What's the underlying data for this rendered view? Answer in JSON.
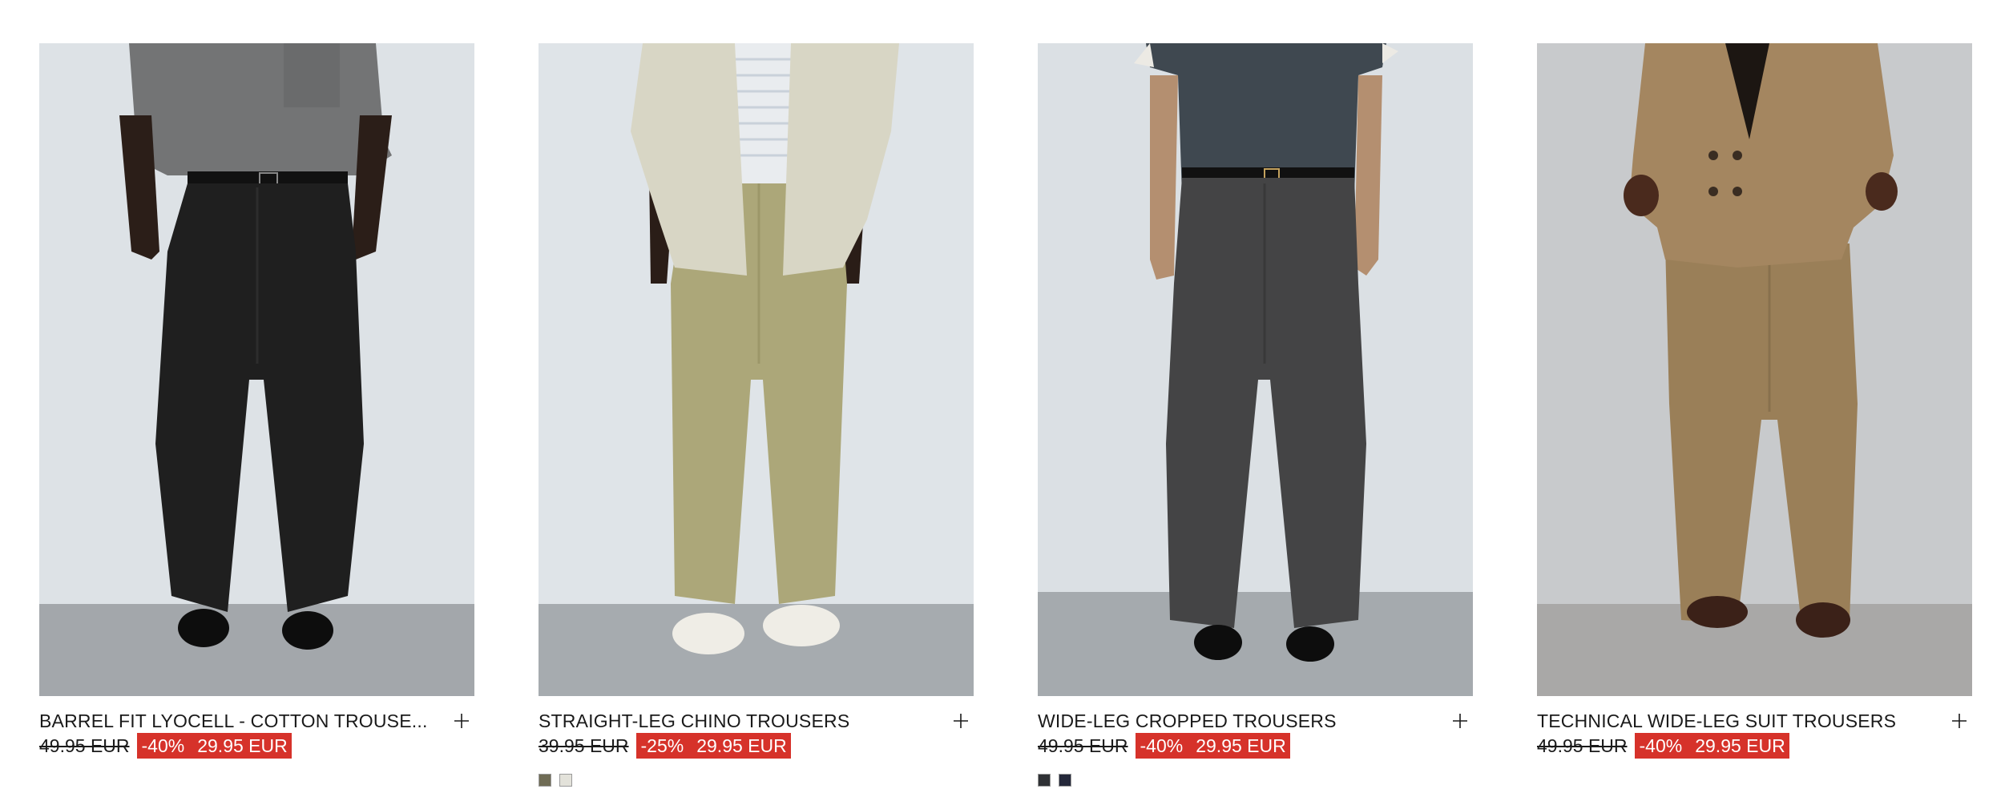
{
  "products": [
    {
      "name": "BARREL FIT LYOCELL - COTTON TROUSE...",
      "old_price": "49.95 EUR",
      "discount": "-40%",
      "new_price": "29.95 EUR",
      "add_icon": "plus-icon",
      "swatches": []
    },
    {
      "name": "STRAIGHT-LEG CHINO TROUSERS",
      "old_price": "39.95 EUR",
      "discount": "-25%",
      "new_price": "29.95 EUR",
      "add_icon": "plus-icon",
      "swatches": [
        "#6f6c55",
        "#e3e2da"
      ]
    },
    {
      "name": "WIDE-LEG CROPPED TROUSERS",
      "old_price": "49.95 EUR",
      "discount": "-40%",
      "new_price": "29.95 EUR",
      "add_icon": "plus-icon",
      "swatches": [
        "#2f3135",
        "#24283a"
      ]
    },
    {
      "name": "TECHNICAL WIDE-LEG SUIT TROUSERS",
      "old_price": "49.95 EUR",
      "discount": "-40%",
      "new_price": "29.95 EUR",
      "add_icon": "plus-icon",
      "swatches": []
    }
  ],
  "colors": {
    "sale_background": "#d6322a",
    "sale_text": "#ffffff",
    "text": "#1a1a1a"
  }
}
